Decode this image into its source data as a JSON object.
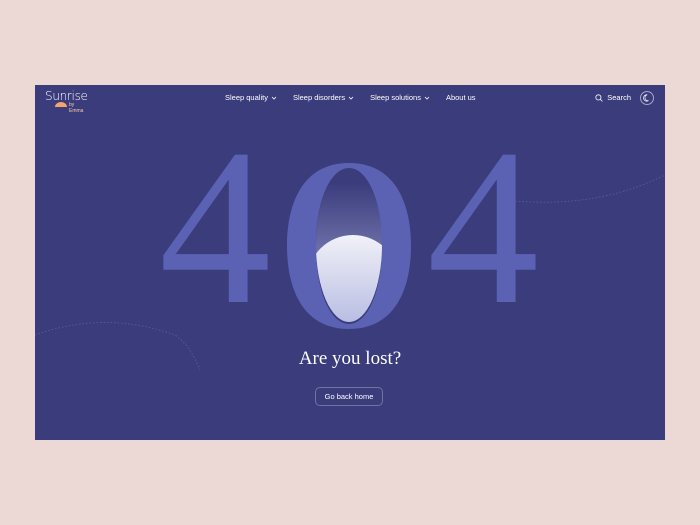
{
  "logo": {
    "main": "Sunrise",
    "sub": "by Emma"
  },
  "nav": {
    "items": [
      {
        "label": "Sleep quality",
        "has_dropdown": true
      },
      {
        "label": "Sleep disorders",
        "has_dropdown": true
      },
      {
        "label": "Sleep solutions",
        "has_dropdown": true
      },
      {
        "label": "About us",
        "has_dropdown": false
      }
    ],
    "search_label": "Search",
    "search_icon": "search-icon",
    "theme_icon": "moon-icon"
  },
  "error": {
    "digit_left": "4",
    "digit_middle": "0",
    "digit_right": "4",
    "title": "Are you lost?",
    "button_label": "Go back home"
  },
  "colors": {
    "page_bg": "#ecd9d6",
    "frame_bg": "#3b3c7c",
    "digits": "#5c62b3",
    "logo_accent": "#f4c9a6"
  }
}
